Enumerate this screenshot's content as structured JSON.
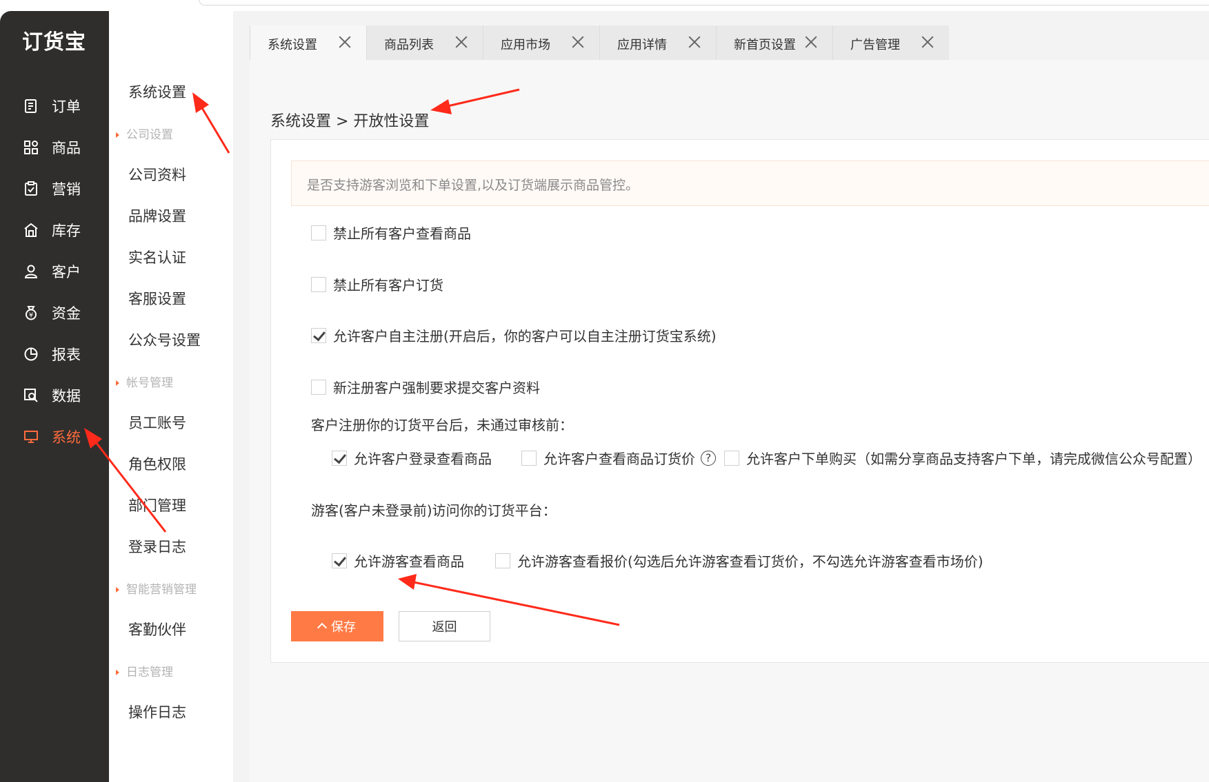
{
  "app": {
    "logo": "订货宝"
  },
  "nav": {
    "items": [
      {
        "label": "订单",
        "icon": "order-icon"
      },
      {
        "label": "商品",
        "icon": "grid-icon"
      },
      {
        "label": "营销",
        "icon": "clipboard-check-icon"
      },
      {
        "label": "库存",
        "icon": "warehouse-icon"
      },
      {
        "label": "客户",
        "icon": "user-icon"
      },
      {
        "label": "资金",
        "icon": "money-bag-icon"
      },
      {
        "label": "报表",
        "icon": "pie-chart-icon"
      },
      {
        "label": "数据",
        "icon": "data-search-icon"
      },
      {
        "label": "系统",
        "icon": "monitor-icon",
        "active": true
      }
    ],
    "active_color": "#ff6b3d"
  },
  "submenu": {
    "title": "系统设置",
    "group_company": "公司设置",
    "company_profile": "公司资料",
    "brand_settings": "品牌设置",
    "real_name": "实名认证",
    "customer_service": "客服设置",
    "official_account": "公众号设置",
    "group_account": "帐号管理",
    "staff_account": "员工账号",
    "role_permission": "角色权限",
    "department": "部门管理",
    "login_log": "登录日志",
    "group_smart_marketing": "智能营销管理",
    "partner": "客勤伙伴",
    "group_log": "日志管理",
    "operation_log": "操作日志"
  },
  "tabs": [
    {
      "label": "系统设置",
      "active": true
    },
    {
      "label": "商品列表"
    },
    {
      "label": "应用市场"
    },
    {
      "label": "应用详情"
    },
    {
      "label": "新首页设置"
    },
    {
      "label": "广告管理"
    }
  ],
  "breadcrumb": "系统设置 > 开放性设置",
  "notice": "是否支持游客浏览和下单设置,以及订货端展示商品管控。",
  "options": {
    "forbid_view": {
      "label": "禁止所有客户查看商品",
      "checked": false
    },
    "forbid_order": {
      "label": "禁止所有客户订货",
      "checked": false
    },
    "allow_register": {
      "label": "允许客户自主注册(开启后，你的客户可以自主注册订货宝系统)",
      "checked": true
    },
    "require_info": {
      "label": "新注册客户强制要求提交客户资料",
      "checked": false
    }
  },
  "unapproved": {
    "heading": "客户注册你的订货平台后，未通过审核前：",
    "allow_login_view": {
      "label": "允许客户登录查看商品",
      "checked": true
    },
    "allow_view_price": {
      "label": "允许客户查看商品订货价",
      "checked": false
    },
    "help_glyph": "?",
    "allow_order": {
      "label": "允许客户下单购买（如需分享商品支持客户下单，请完成微信公众号配置）",
      "checked": false
    }
  },
  "guest": {
    "heading": "游客(客户未登录前)访问你的订货平台：",
    "allow_view": {
      "label": "允许游客查看商品",
      "checked": true
    },
    "allow_price": {
      "label": "允许游客查看报价(勾选后允许游客查看订货价，不勾选允许游客查看市场价)",
      "checked": false
    }
  },
  "buttons": {
    "save": "保存",
    "back": "返回"
  },
  "colors": {
    "sidebar": "#2f2e2c",
    "accent": "#ff7a45",
    "arrow": "#ff2a1a"
  }
}
